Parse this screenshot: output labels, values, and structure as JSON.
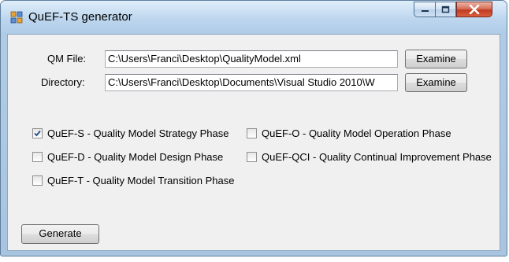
{
  "window": {
    "title": "QuEF-TS generator"
  },
  "form": {
    "qm_file_label": "QM File:",
    "qm_file_value": "C:\\Users\\Franci\\Desktop\\QualityModel.xml",
    "qm_file_button": "Examine",
    "directory_label": "Directory:",
    "directory_value": "C:\\Users\\Franci\\Desktop\\Documents\\Visual Studio 2010\\W",
    "directory_button": "Examine"
  },
  "phases": [
    {
      "label": "QuEF-S - Quality Model Strategy Phase",
      "checked": true
    },
    {
      "label": "QuEF-O - Quality Model Operation Phase",
      "checked": false
    },
    {
      "label": "QuEF-D - Quality Model Design Phase",
      "checked": false
    },
    {
      "label": "QuEF-QCI - Quality Continual Improvement Phase",
      "checked": false
    },
    {
      "label": "QuEF-T - Quality Model Transition Phase",
      "checked": false
    }
  ],
  "generate_button": "Generate",
  "colors": {
    "titlebar": "#bdd6ee",
    "client_background": "#f0f0f0",
    "close_button": "#c23a20"
  }
}
